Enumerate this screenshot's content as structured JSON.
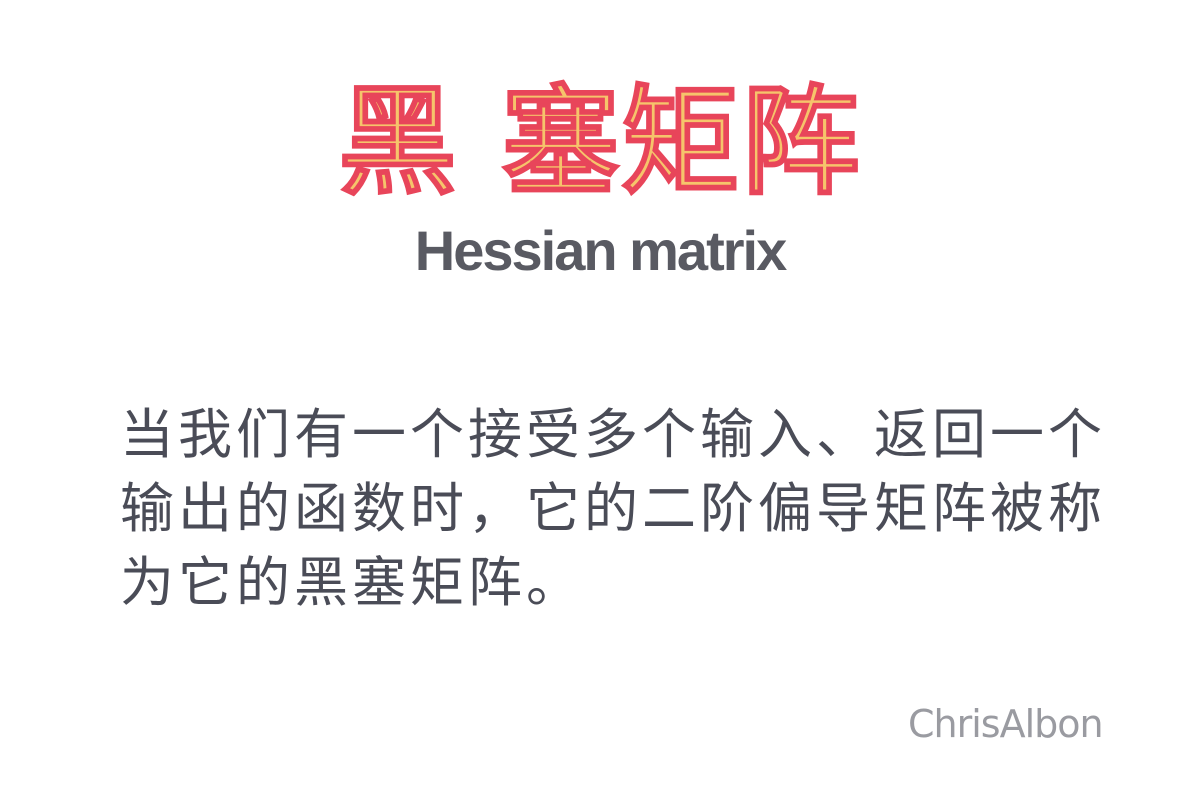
{
  "title": {
    "chinese": "黑 塞矩阵",
    "english": "Hessian matrix"
  },
  "body": {
    "text": "当我们有一个接受多个输入、返回一个输出的函数时，它的二阶偏导矩阵被称为它的黑塞矩阵。"
  },
  "signature": {
    "text": "ChrisAlbon"
  },
  "colors": {
    "title_fill": "#f6c46b",
    "title_outline": "#e8455a",
    "text_dark": "#4a4c57",
    "signature_gray": "#9a9ba1",
    "background": "#ffffff"
  }
}
